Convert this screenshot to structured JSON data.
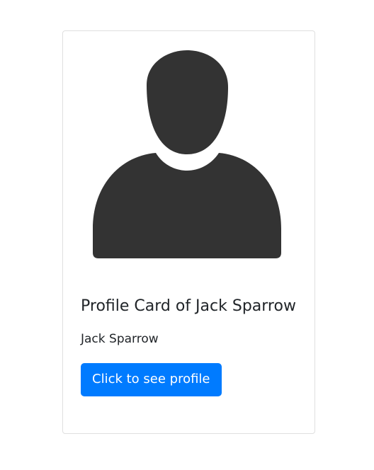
{
  "card": {
    "image_icon": "user-silhouette-icon",
    "title": "Profile Card of Jack Sparrow",
    "text": "Jack Sparrow",
    "button_label": "Click to see profile"
  },
  "colors": {
    "button_bg": "#007bff",
    "button_text": "#ffffff",
    "silhouette": "#333333",
    "text": "#212529",
    "border": "#dfdfdf"
  }
}
